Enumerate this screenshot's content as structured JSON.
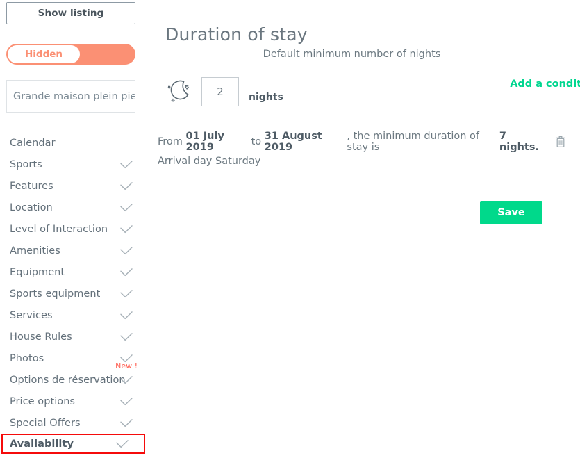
{
  "sidebar": {
    "show_listing_label": "Show listing",
    "visibility_toggle": {
      "label": "Hidden",
      "state": "hidden",
      "track_color": "#fb9074",
      "knob_color": "#ffffff",
      "label_color": "#fb9074"
    },
    "listing_name": "Grande maison plein pieds",
    "items": [
      {
        "label": "Calendar",
        "checked": false,
        "badge": null,
        "highlighted": false
      },
      {
        "label": "Sports",
        "checked": true,
        "badge": null,
        "highlighted": false
      },
      {
        "label": "Features",
        "checked": true,
        "badge": null,
        "highlighted": false
      },
      {
        "label": "Location",
        "checked": true,
        "badge": null,
        "highlighted": false
      },
      {
        "label": "Level of Interaction",
        "checked": true,
        "badge": null,
        "highlighted": false
      },
      {
        "label": "Amenities",
        "checked": true,
        "badge": null,
        "highlighted": false
      },
      {
        "label": "Equipment",
        "checked": true,
        "badge": null,
        "highlighted": false
      },
      {
        "label": "Sports equipment",
        "checked": true,
        "badge": null,
        "highlighted": false
      },
      {
        "label": "Services",
        "checked": true,
        "badge": null,
        "highlighted": false
      },
      {
        "label": "House Rules",
        "checked": true,
        "badge": null,
        "highlighted": false
      },
      {
        "label": "Photos",
        "checked": true,
        "badge": null,
        "highlighted": false
      },
      {
        "label": "Options de réservation",
        "checked": true,
        "badge": "New !",
        "highlighted": false
      },
      {
        "label": "Price options",
        "checked": true,
        "badge": null,
        "highlighted": false
      },
      {
        "label": "Special Offers",
        "checked": true,
        "badge": null,
        "highlighted": false
      },
      {
        "label": "Availability",
        "checked": true,
        "badge": null,
        "highlighted": true
      }
    ],
    "badge_color": "#ff5a4d",
    "highlight_color": "#f50b0b"
  },
  "main": {
    "title": "Duration of stay",
    "subtitle": "Default minimum number of nights",
    "nights_value": "2",
    "nights_unit": "nights",
    "add_condition_label": "Add a condition depending on the period",
    "add_condition_color": "#00d68f",
    "condition": {
      "prefix": "From",
      "start_date": "01 July 2019",
      "middle": "to",
      "end_date": "31 August 2019",
      "suffix": ", the minimum duration of stay is",
      "minimum": "7 nights.",
      "delete_title": "Delete condition"
    },
    "arrival_day": "Arrival day Saturday",
    "save_label": "Save",
    "save_color": "#00d98b"
  }
}
